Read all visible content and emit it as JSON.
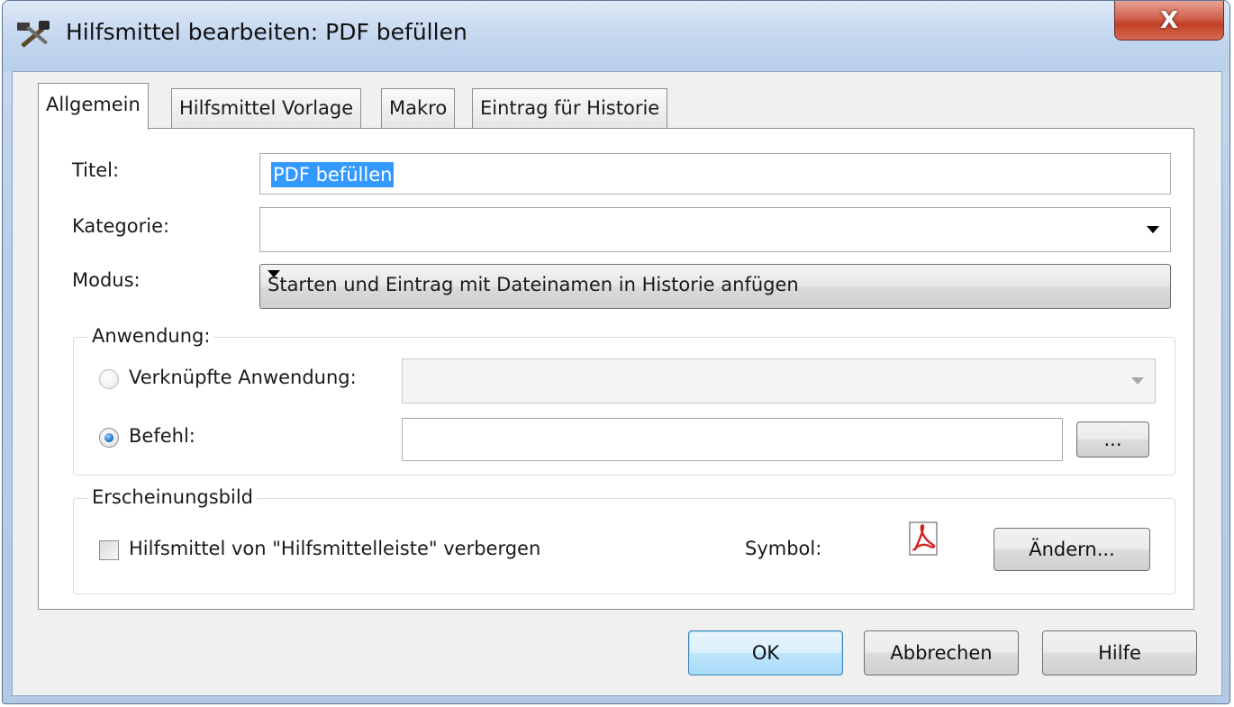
{
  "window": {
    "title": "Hilfsmittel bearbeiten: PDF befüllen",
    "close_glyph": "X"
  },
  "tabs": [
    {
      "label": "Allgemein",
      "active": true
    },
    {
      "label": "Hilfsmittel Vorlage",
      "active": false
    },
    {
      "label": "Makro",
      "active": false
    },
    {
      "label": "Eintrag für Historie",
      "active": false
    }
  ],
  "form": {
    "title_label": "Titel:",
    "title_value": "PDF befüllen",
    "category_label": "Kategorie:",
    "category_value": "",
    "mode_label": "Modus:",
    "mode_value": "Starten und Eintrag mit Dateinamen in Historie anfügen"
  },
  "application_group": {
    "title": "Anwendung:",
    "linked_app_label": "Verknüpfte Anwendung:",
    "linked_app_selected": false,
    "command_label": "Befehl:",
    "command_selected": true,
    "command_value": "",
    "browse_label": "..."
  },
  "appearance_group": {
    "title": "Erscheinungsbild",
    "hide_checkbox_label": "Hilfsmittel von \"Hilfsmittelleiste\" verbergen",
    "hide_checked": false,
    "symbol_label": "Symbol:",
    "symbol_icon": "pdf-icon",
    "change_button_label": "Ändern..."
  },
  "buttons": {
    "ok": "OK",
    "cancel": "Abbrechen",
    "help": "Hilfe"
  },
  "colors": {
    "selection": "#3399ff",
    "close_button": "#c14026",
    "default_button": "#bee6fd"
  }
}
